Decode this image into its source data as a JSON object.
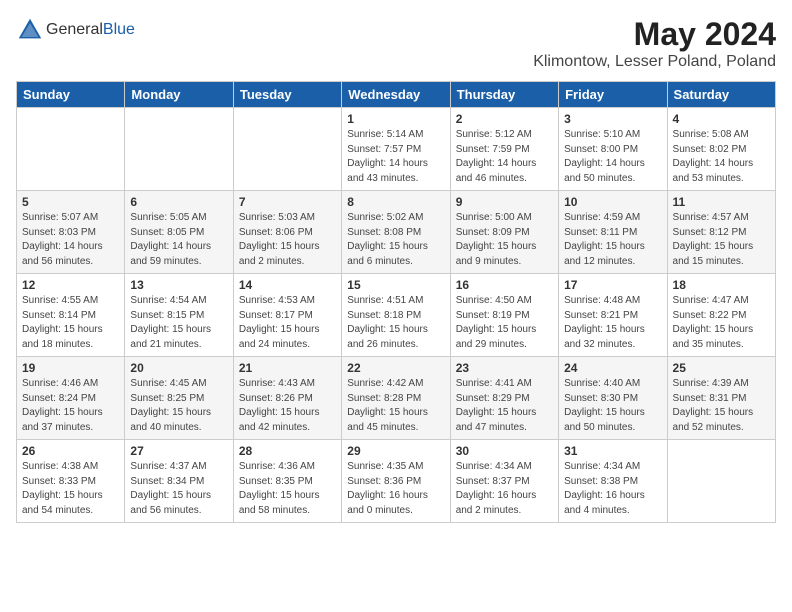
{
  "header": {
    "logo": {
      "general": "General",
      "blue": "Blue"
    },
    "title": "May 2024",
    "location": "Klimontow, Lesser Poland, Poland"
  },
  "weekdays": [
    "Sunday",
    "Monday",
    "Tuesday",
    "Wednesday",
    "Thursday",
    "Friday",
    "Saturday"
  ],
  "weeks": [
    [
      {
        "day": "",
        "info": ""
      },
      {
        "day": "",
        "info": ""
      },
      {
        "day": "",
        "info": ""
      },
      {
        "day": "1",
        "info": "Sunrise: 5:14 AM\nSunset: 7:57 PM\nDaylight: 14 hours\nand 43 minutes."
      },
      {
        "day": "2",
        "info": "Sunrise: 5:12 AM\nSunset: 7:59 PM\nDaylight: 14 hours\nand 46 minutes."
      },
      {
        "day": "3",
        "info": "Sunrise: 5:10 AM\nSunset: 8:00 PM\nDaylight: 14 hours\nand 50 minutes."
      },
      {
        "day": "4",
        "info": "Sunrise: 5:08 AM\nSunset: 8:02 PM\nDaylight: 14 hours\nand 53 minutes."
      }
    ],
    [
      {
        "day": "5",
        "info": "Sunrise: 5:07 AM\nSunset: 8:03 PM\nDaylight: 14 hours\nand 56 minutes."
      },
      {
        "day": "6",
        "info": "Sunrise: 5:05 AM\nSunset: 8:05 PM\nDaylight: 14 hours\nand 59 minutes."
      },
      {
        "day": "7",
        "info": "Sunrise: 5:03 AM\nSunset: 8:06 PM\nDaylight: 15 hours\nand 2 minutes."
      },
      {
        "day": "8",
        "info": "Sunrise: 5:02 AM\nSunset: 8:08 PM\nDaylight: 15 hours\nand 6 minutes."
      },
      {
        "day": "9",
        "info": "Sunrise: 5:00 AM\nSunset: 8:09 PM\nDaylight: 15 hours\nand 9 minutes."
      },
      {
        "day": "10",
        "info": "Sunrise: 4:59 AM\nSunset: 8:11 PM\nDaylight: 15 hours\nand 12 minutes."
      },
      {
        "day": "11",
        "info": "Sunrise: 4:57 AM\nSunset: 8:12 PM\nDaylight: 15 hours\nand 15 minutes."
      }
    ],
    [
      {
        "day": "12",
        "info": "Sunrise: 4:55 AM\nSunset: 8:14 PM\nDaylight: 15 hours\nand 18 minutes."
      },
      {
        "day": "13",
        "info": "Sunrise: 4:54 AM\nSunset: 8:15 PM\nDaylight: 15 hours\nand 21 minutes."
      },
      {
        "day": "14",
        "info": "Sunrise: 4:53 AM\nSunset: 8:17 PM\nDaylight: 15 hours\nand 24 minutes."
      },
      {
        "day": "15",
        "info": "Sunrise: 4:51 AM\nSunset: 8:18 PM\nDaylight: 15 hours\nand 26 minutes."
      },
      {
        "day": "16",
        "info": "Sunrise: 4:50 AM\nSunset: 8:19 PM\nDaylight: 15 hours\nand 29 minutes."
      },
      {
        "day": "17",
        "info": "Sunrise: 4:48 AM\nSunset: 8:21 PM\nDaylight: 15 hours\nand 32 minutes."
      },
      {
        "day": "18",
        "info": "Sunrise: 4:47 AM\nSunset: 8:22 PM\nDaylight: 15 hours\nand 35 minutes."
      }
    ],
    [
      {
        "day": "19",
        "info": "Sunrise: 4:46 AM\nSunset: 8:24 PM\nDaylight: 15 hours\nand 37 minutes."
      },
      {
        "day": "20",
        "info": "Sunrise: 4:45 AM\nSunset: 8:25 PM\nDaylight: 15 hours\nand 40 minutes."
      },
      {
        "day": "21",
        "info": "Sunrise: 4:43 AM\nSunset: 8:26 PM\nDaylight: 15 hours\nand 42 minutes."
      },
      {
        "day": "22",
        "info": "Sunrise: 4:42 AM\nSunset: 8:28 PM\nDaylight: 15 hours\nand 45 minutes."
      },
      {
        "day": "23",
        "info": "Sunrise: 4:41 AM\nSunset: 8:29 PM\nDaylight: 15 hours\nand 47 minutes."
      },
      {
        "day": "24",
        "info": "Sunrise: 4:40 AM\nSunset: 8:30 PM\nDaylight: 15 hours\nand 50 minutes."
      },
      {
        "day": "25",
        "info": "Sunrise: 4:39 AM\nSunset: 8:31 PM\nDaylight: 15 hours\nand 52 minutes."
      }
    ],
    [
      {
        "day": "26",
        "info": "Sunrise: 4:38 AM\nSunset: 8:33 PM\nDaylight: 15 hours\nand 54 minutes."
      },
      {
        "day": "27",
        "info": "Sunrise: 4:37 AM\nSunset: 8:34 PM\nDaylight: 15 hours\nand 56 minutes."
      },
      {
        "day": "28",
        "info": "Sunrise: 4:36 AM\nSunset: 8:35 PM\nDaylight: 15 hours\nand 58 minutes."
      },
      {
        "day": "29",
        "info": "Sunrise: 4:35 AM\nSunset: 8:36 PM\nDaylight: 16 hours\nand 0 minutes."
      },
      {
        "day": "30",
        "info": "Sunrise: 4:34 AM\nSunset: 8:37 PM\nDaylight: 16 hours\nand 2 minutes."
      },
      {
        "day": "31",
        "info": "Sunrise: 4:34 AM\nSunset: 8:38 PM\nDaylight: 16 hours\nand 4 minutes."
      },
      {
        "day": "",
        "info": ""
      }
    ]
  ]
}
